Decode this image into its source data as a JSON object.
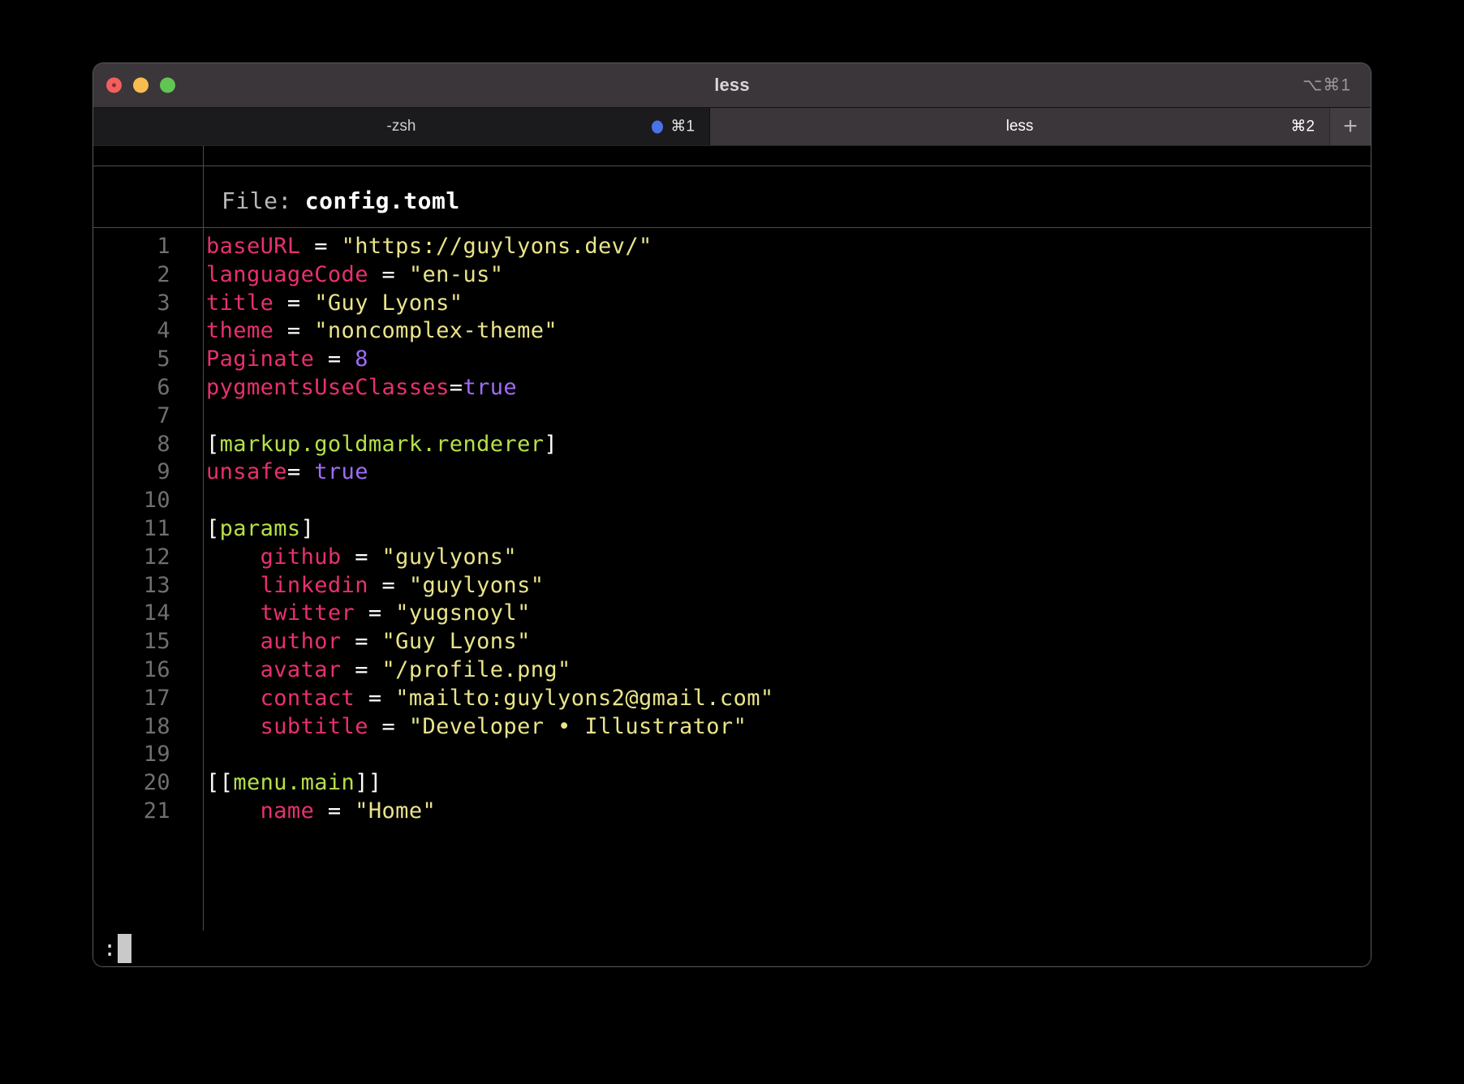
{
  "window": {
    "title": "less",
    "shortcut": "⌥⌘1",
    "traffic_lights": {
      "close": "close-button",
      "minimize": "minimize-button",
      "maximize": "maximize-button"
    }
  },
  "tabs": [
    {
      "label": "-zsh",
      "shortcut": "⌘1",
      "active": false,
      "has_activity_dot": true
    },
    {
      "label": "less",
      "shortcut": "⌘2",
      "active": true,
      "has_activity_dot": false
    }
  ],
  "new_tab_label": "+",
  "pager": {
    "file_label": "File:",
    "file_name": "config.toml",
    "prompt": ":",
    "lines": [
      {
        "no": "1",
        "tokens": [
          {
            "t": "baseURL",
            "c": "k"
          },
          {
            "t": " = ",
            "c": "p"
          },
          {
            "t": "\"https://guylyons.dev/\"",
            "c": "s"
          }
        ]
      },
      {
        "no": "2",
        "tokens": [
          {
            "t": "languageCode",
            "c": "k"
          },
          {
            "t": " = ",
            "c": "p"
          },
          {
            "t": "\"en-us\"",
            "c": "s"
          }
        ]
      },
      {
        "no": "3",
        "tokens": [
          {
            "t": "title",
            "c": "k"
          },
          {
            "t": " = ",
            "c": "p"
          },
          {
            "t": "\"Guy Lyons\"",
            "c": "s"
          }
        ]
      },
      {
        "no": "4",
        "tokens": [
          {
            "t": "theme",
            "c": "k"
          },
          {
            "t": " = ",
            "c": "p"
          },
          {
            "t": "\"noncomplex-theme\"",
            "c": "s"
          }
        ]
      },
      {
        "no": "5",
        "tokens": [
          {
            "t": "Paginate",
            "c": "k"
          },
          {
            "t": " = ",
            "c": "p"
          },
          {
            "t": "8",
            "c": "n"
          }
        ]
      },
      {
        "no": "6",
        "tokens": [
          {
            "t": "pygmentsUseClasses",
            "c": "k"
          },
          {
            "t": "=",
            "c": "p"
          },
          {
            "t": "true",
            "c": "n"
          }
        ]
      },
      {
        "no": "7",
        "tokens": []
      },
      {
        "no": "8",
        "tokens": [
          {
            "t": "[",
            "c": "p"
          },
          {
            "t": "markup.goldmark.renderer",
            "c": "sec"
          },
          {
            "t": "]",
            "c": "p"
          }
        ]
      },
      {
        "no": "9",
        "tokens": [
          {
            "t": "unsafe",
            "c": "k"
          },
          {
            "t": "= ",
            "c": "p"
          },
          {
            "t": "true",
            "c": "n"
          }
        ]
      },
      {
        "no": "10",
        "tokens": []
      },
      {
        "no": "11",
        "tokens": [
          {
            "t": "[",
            "c": "p"
          },
          {
            "t": "params",
            "c": "sec"
          },
          {
            "t": "]",
            "c": "p"
          }
        ]
      },
      {
        "no": "12",
        "tokens": [
          {
            "t": "    github",
            "c": "k"
          },
          {
            "t": " = ",
            "c": "p"
          },
          {
            "t": "\"guylyons\"",
            "c": "s"
          }
        ]
      },
      {
        "no": "13",
        "tokens": [
          {
            "t": "    linkedin",
            "c": "k"
          },
          {
            "t": " = ",
            "c": "p"
          },
          {
            "t": "\"guylyons\"",
            "c": "s"
          }
        ]
      },
      {
        "no": "14",
        "tokens": [
          {
            "t": "    twitter",
            "c": "k"
          },
          {
            "t": " = ",
            "c": "p"
          },
          {
            "t": "\"yugsnoyl\"",
            "c": "s"
          }
        ]
      },
      {
        "no": "15",
        "tokens": [
          {
            "t": "    author",
            "c": "k"
          },
          {
            "t": " = ",
            "c": "p"
          },
          {
            "t": "\"Guy Lyons\"",
            "c": "s"
          }
        ]
      },
      {
        "no": "16",
        "tokens": [
          {
            "t": "    avatar",
            "c": "k"
          },
          {
            "t": " = ",
            "c": "p"
          },
          {
            "t": "\"/profile.png\"",
            "c": "s"
          }
        ]
      },
      {
        "no": "17",
        "tokens": [
          {
            "t": "    contact",
            "c": "k"
          },
          {
            "t": " = ",
            "c": "p"
          },
          {
            "t": "\"mailto:guylyons2@gmail.com\"",
            "c": "s"
          }
        ]
      },
      {
        "no": "18",
        "tokens": [
          {
            "t": "    subtitle",
            "c": "k"
          },
          {
            "t": " = ",
            "c": "p"
          },
          {
            "t": "\"Developer • Illustrator\"",
            "c": "s"
          }
        ]
      },
      {
        "no": "19",
        "tokens": []
      },
      {
        "no": "20",
        "tokens": [
          {
            "t": "[[",
            "c": "p"
          },
          {
            "t": "menu.main",
            "c": "sec"
          },
          {
            "t": "]]",
            "c": "p"
          }
        ]
      },
      {
        "no": "21",
        "tokens": [
          {
            "t": "    name",
            "c": "k"
          },
          {
            "t": " = ",
            "c": "p"
          },
          {
            "t": "\"Home\"",
            "c": "s"
          }
        ]
      }
    ]
  },
  "colors": {
    "background": "#000000",
    "titlebar": "#3a3639",
    "tab_inactive": "#1b1a1c",
    "key": "#e8316c",
    "string": "#e9e48a",
    "number": "#a06cf5",
    "section": "#b5e04a",
    "activity_dot": "#4a72e8"
  }
}
